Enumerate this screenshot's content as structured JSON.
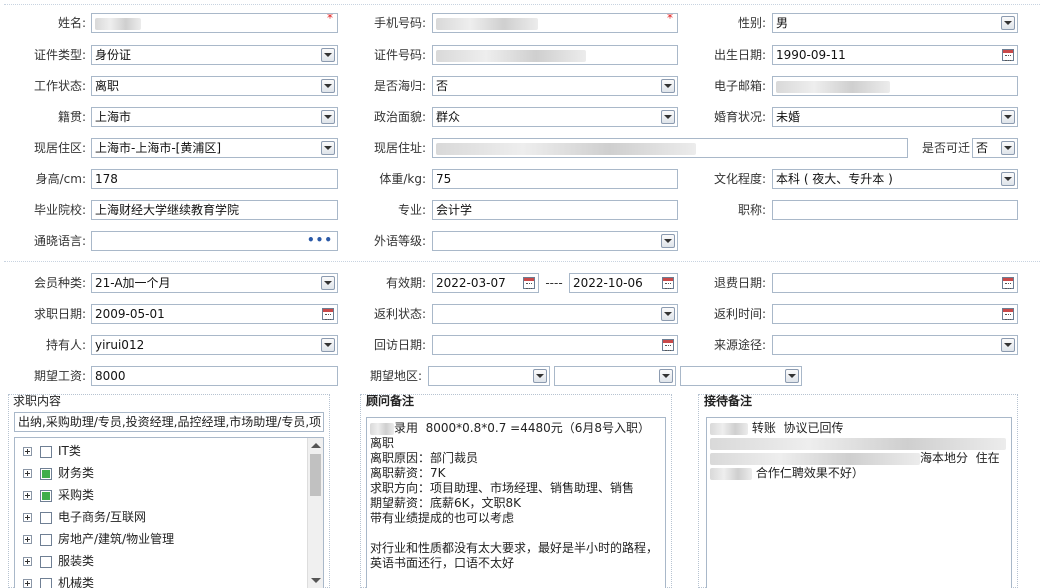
{
  "personal": {
    "name_label": "姓名:",
    "mobile_label": "手机号码:",
    "gender_label": "性别:",
    "gender_value": "男",
    "id_type_label": "证件类型:",
    "id_type_value": "身份证",
    "id_no_label": "证件号码:",
    "birth_label": "出生日期:",
    "birth_value": "1990-09-11",
    "work_status_label": "工作状态:",
    "work_status_value": "离职",
    "returnee_label": "是否海归:",
    "returnee_value": "否",
    "email_label": "电子邮箱:",
    "native_label": "籍贯:",
    "native_value": "上海市",
    "political_label": "政治面貌:",
    "political_value": "群众",
    "marital_label": "婚育状况:",
    "marital_value": "未婚",
    "district_label": "现居住区:",
    "district_value": "上海市-上海市-[黄浦区]",
    "address_label": "现居住址:",
    "relocate_label": "是否可迁",
    "relocate_value": "否",
    "height_label": "身高/cm:",
    "height_value": "178",
    "weight_label": "体重/kg:",
    "weight_value": "75",
    "education_label": "文化程度:",
    "education_value": "本科 ( 夜大、专升本 )",
    "school_label": "毕业院校:",
    "school_value": "上海财经大学继续教育学院",
    "major_label": "专业:",
    "major_value": "会计学",
    "title_label": "职称:",
    "language_label": "通晓语言:",
    "foreign_level_label": "外语等级:"
  },
  "membership": {
    "type_label": "会员种类:",
    "type_value": "21-A加一个月",
    "valid_label": "有效期:",
    "valid_from": "2022-03-07",
    "valid_sep": "----",
    "valid_to": "2022-10-06",
    "refund_label": "退费日期:",
    "apply_date_label": "求职日期:",
    "apply_date_value": "2009-05-01",
    "rebate_status_label": "返利状态:",
    "rebate_time_label": "返利时间:",
    "holder_label": "持有人:",
    "holder_value": "yirui012",
    "visit_date_label": "回访日期:",
    "source_label": "来源途径:",
    "salary_label": "期望工资:",
    "salary_value": "8000",
    "area_label": "期望地区:"
  },
  "job_content": {
    "title": "求职内容",
    "summary": "出纳,采购助理/专员,投资经理,品控经理,市场助理/专员,项目",
    "categories": [
      {
        "label": "IT类",
        "checked": false
      },
      {
        "label": "财务类",
        "checked": true
      },
      {
        "label": "采购类",
        "checked": true
      },
      {
        "label": "电子商务/互联网",
        "checked": false
      },
      {
        "label": "房地产/建筑/物业管理",
        "checked": false
      },
      {
        "label": "服装类",
        "checked": false
      },
      {
        "label": "机械类",
        "checked": false
      }
    ]
  },
  "consultant_note": {
    "title": "顾问备注",
    "lines": [
      "录用  8000*0.8*0.7 =4480元（6月8号入职）",
      "离职",
      "离职原因：部门裁员",
      "离职薪资：7K",
      "求职方向：项目助理、市场经理、销售助理、销售",
      "期望薪资：底薪6K，文职8K",
      "带有业绩提成的也可以考虑",
      "",
      "对行业和性质都没有太大要求，最好是半小时的路程，",
      "英语书面还行，口语不太好"
    ]
  },
  "reception_note": {
    "title": "接待备注",
    "line1": "转账  协议已回传",
    "line2": "海本地分  住在",
    "line3": "合作仁聘效果不好）"
  },
  "colors": {
    "required": "#e02020",
    "checked": "#3fae49",
    "border": "#a9b8c9"
  }
}
